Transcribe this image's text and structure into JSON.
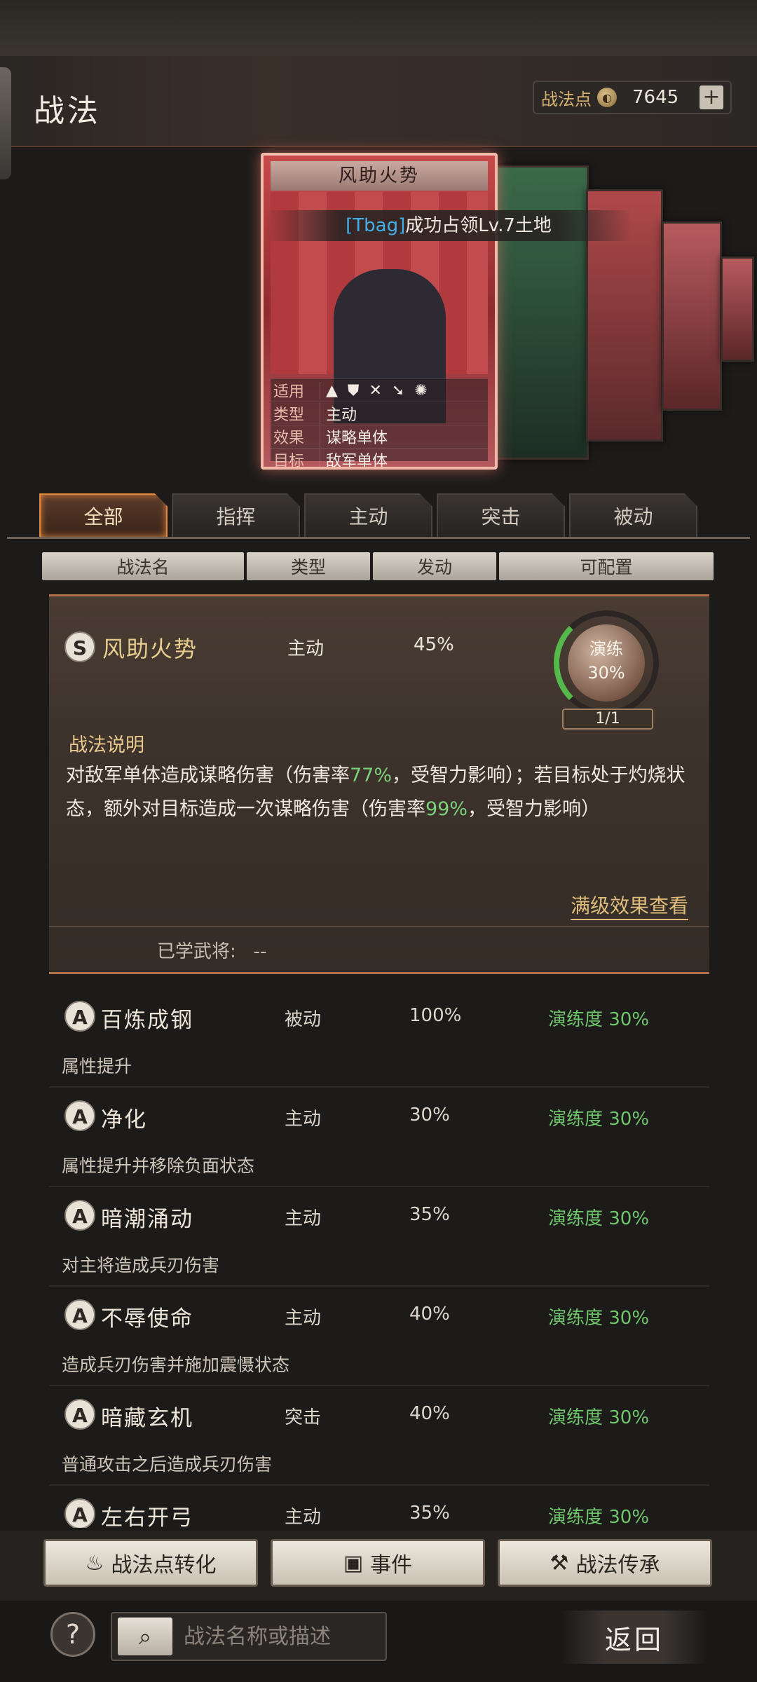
{
  "header": {
    "title": "战法",
    "points_label": "战法点",
    "points_value": "7645",
    "plus": "+"
  },
  "notice": {
    "player": "[Tbag]",
    "message": "成功占领Lv.7土地"
  },
  "card": {
    "title": "风助火势",
    "rows": [
      {
        "key": "适用",
        "value": ""
      },
      {
        "key": "类型",
        "value": "主动"
      },
      {
        "key": "效果",
        "value": "谋略单体"
      },
      {
        "key": "目标",
        "value": "敌军单体"
      }
    ],
    "applicable_icons": [
      "cavalry-icon",
      "shield-icon",
      "bow-icon",
      "spear-icon",
      "wheel-icon"
    ]
  },
  "tabs": [
    {
      "label": "全部",
      "active": true
    },
    {
      "label": "指挥",
      "active": false
    },
    {
      "label": "主动",
      "active": false
    },
    {
      "label": "突击",
      "active": false
    },
    {
      "label": "被动",
      "active": false
    }
  ],
  "columns": [
    "战法名",
    "类型",
    "发动",
    "可配置"
  ],
  "selected": {
    "grade": "S",
    "name": "风助火势",
    "type": "主动",
    "rate": "45%",
    "drill_label": "演练",
    "drill_value": "30%",
    "drill_count": "1/1",
    "drill_progress": 0.3,
    "desc_title": "战法说明",
    "desc_part1": "对敌军单体造成谋略伤害（伤害率",
    "desc_rate1": "77%",
    "desc_part2": "，受智力影响）；若目标处于灼烧状态，额外对目标造成一次谋略伤害（伤害率",
    "desc_rate2": "99%",
    "desc_part3": "，受智力影响）",
    "max_link": "满级效果查看",
    "learned_label": "已学武将:",
    "learned_value": "--"
  },
  "list": [
    {
      "grade": "A",
      "name": "百炼成钢",
      "type": "被动",
      "rate": "100%",
      "drill": "演练度 30%",
      "desc": "属性提升"
    },
    {
      "grade": "A",
      "name": "净化",
      "type": "主动",
      "rate": "30%",
      "drill": "演练度 30%",
      "desc": "属性提升并移除负面状态"
    },
    {
      "grade": "A",
      "name": "暗潮涌动",
      "type": "主动",
      "rate": "35%",
      "drill": "演练度 30%",
      "desc": "对主将造成兵刃伤害"
    },
    {
      "grade": "A",
      "name": "不辱使命",
      "type": "主动",
      "rate": "40%",
      "drill": "演练度 30%",
      "desc": "造成兵刃伤害并施加震慑状态"
    },
    {
      "grade": "A",
      "name": "暗藏玄机",
      "type": "突击",
      "rate": "40%",
      "drill": "演练度 30%",
      "desc": "普通攻击之后造成兵刃伤害"
    },
    {
      "grade": "A",
      "name": "左右开弓",
      "type": "主动",
      "rate": "35%",
      "drill": "演练度 30%",
      "desc": ""
    }
  ],
  "actions": {
    "convert": "战法点转化",
    "event": "事件",
    "inherit": "战法传承"
  },
  "footer": {
    "help": "?",
    "search_placeholder": "战法名称或描述",
    "back": "返回"
  }
}
